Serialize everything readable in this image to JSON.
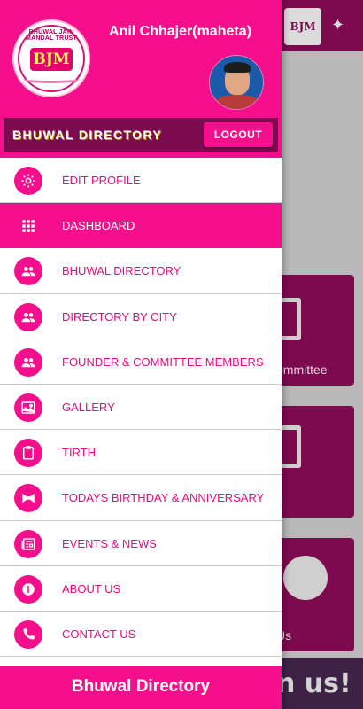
{
  "background": {
    "logo_text": "BJM",
    "cards": [
      {
        "label": "ommittee"
      },
      {
        "label": "s"
      },
      {
        "label": "Us"
      }
    ],
    "banner_text": "n us!"
  },
  "drawer": {
    "header": {
      "logo_text": "BJM",
      "logo_trust_text": "BHUWAL JAIN MANDAL TRUST",
      "user_name": "Anil Chhajer(maheta)",
      "directory_title": "BHUWAL DIRECTORY",
      "logout_label": "LOGOUT"
    },
    "menu": [
      {
        "label": "EDIT PROFILE",
        "icon": "gear-icon",
        "active": false
      },
      {
        "label": "DASHBOARD",
        "icon": "grid-icon",
        "active": true
      },
      {
        "label": "BHUWAL DIRECTORY",
        "icon": "people-icon",
        "active": false
      },
      {
        "label": "DIRECTORY BY CITY",
        "icon": "people-icon",
        "active": false
      },
      {
        "label": "FOUNDER & COMMITTEE MEMBERS",
        "icon": "people-icon",
        "active": false
      },
      {
        "label": "GALLERY",
        "icon": "image-icon",
        "active": false
      },
      {
        "label": "TIRTH",
        "icon": "clipboard-icon",
        "active": false
      },
      {
        "label": "TODAYS BIRTHDAY & ANNIVERSARY",
        "icon": "bow-icon",
        "active": false
      },
      {
        "label": "EVENTS & NEWS",
        "icon": "newspaper-icon",
        "active": false
      },
      {
        "label": "ABOUT US",
        "icon": "info-icon",
        "active": false
      },
      {
        "label": "CONTACT US",
        "icon": "phone-icon",
        "active": false
      }
    ],
    "footer_title": "Bhuwal Directory"
  },
  "colors": {
    "accent": "#f50f8c",
    "dark_accent": "#7d0a4e",
    "menu_text": "#e60c81"
  }
}
